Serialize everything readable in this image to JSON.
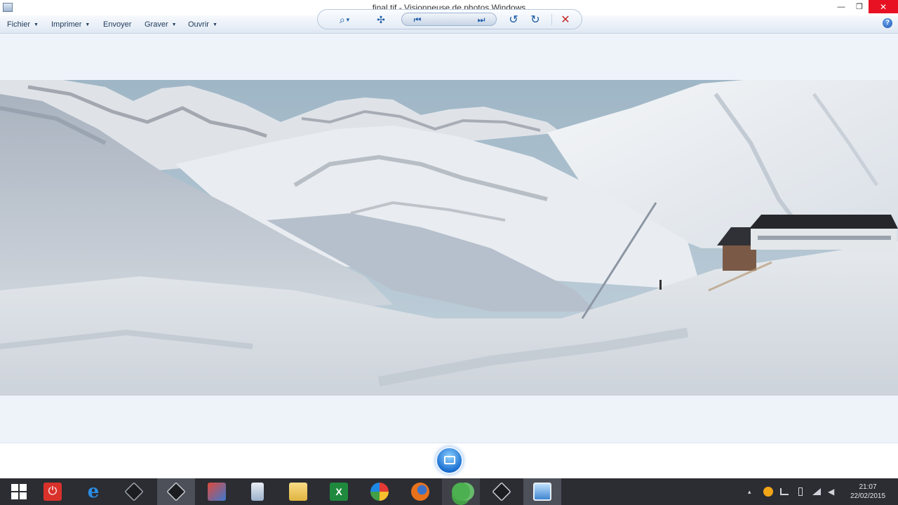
{
  "window": {
    "title": "final.tif - Visionneuse de photos Windows",
    "minimize_glyph": "—",
    "maximize_glyph": "❐",
    "close_glyph": "✕"
  },
  "menu": {
    "items": [
      {
        "label": "Fichier",
        "dropdown": "▼"
      },
      {
        "label": "Imprimer",
        "dropdown": "▼"
      },
      {
        "label": "Envoyer",
        "dropdown": ""
      },
      {
        "label": "Graver",
        "dropdown": "▼"
      },
      {
        "label": "Ouvrir",
        "dropdown": "▼"
      }
    ],
    "help_glyph": "?"
  },
  "controls": {
    "zoom_glyph": "⌕",
    "zoom_dropdown": "▾",
    "fit_glyph": "✣",
    "prev_glyph": "⏮",
    "next_glyph": "⏭",
    "rotate_ccw_glyph": "↺",
    "rotate_cw_glyph": "↻",
    "delete_glyph": "✕"
  },
  "taskbar": {
    "clock_time": "21:07",
    "clock_date": "22/02/2015",
    "tray_expand_glyph": "▴",
    "colors": {
      "power": "#d9322b",
      "ie": "#2a8ee6",
      "excel": "#1f8a3e",
      "firefox": "#e8721c"
    }
  },
  "colors": {
    "accent": "#1a6fd1",
    "titlebar_close": "#e81123",
    "taskbar_bg": "#2b2d33"
  }
}
